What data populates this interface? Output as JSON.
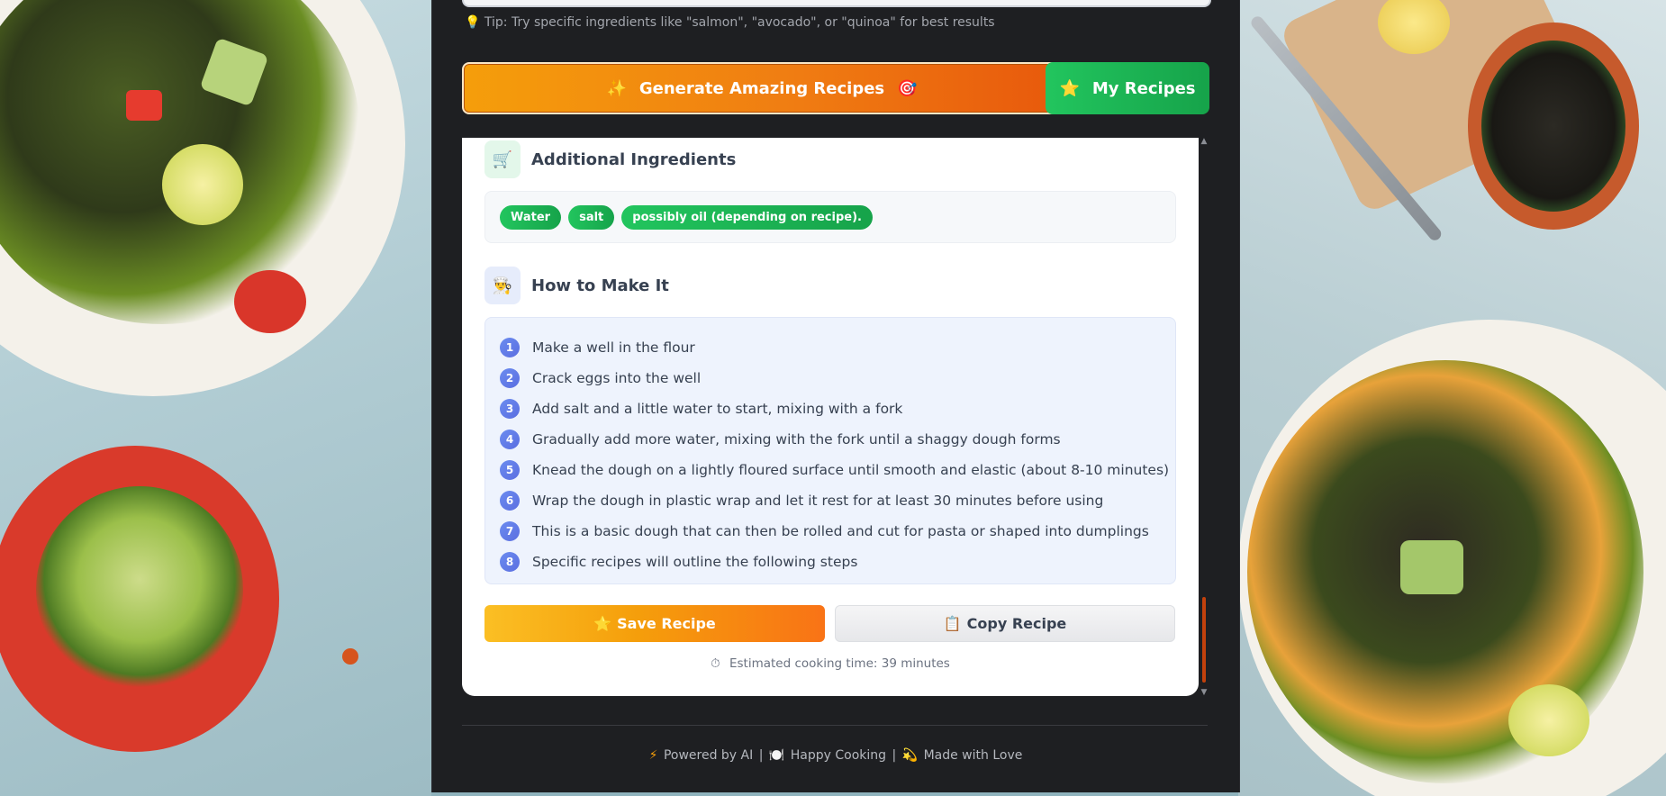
{
  "search": {
    "tip_icon": "lightbulb-icon",
    "tip": "Tip: Try specific ingredients like \"salmon\", \"avocado\", or \"quinoa\" for best results"
  },
  "actions": {
    "generate_label": "Generate Amazing Recipes",
    "generate_icon_left": "sparkles-icon",
    "generate_icon_right": "target-icon",
    "my_recipes_label": "My Recipes",
    "my_recipes_icon": "star-icon"
  },
  "recipe": {
    "additional_ingredients": {
      "title": "Additional Ingredients",
      "icon": "cart-icon",
      "items": [
        "Water",
        "salt",
        "possibly oil (depending on recipe)."
      ]
    },
    "how_to": {
      "title": "How to Make It",
      "icon": "chef-icon",
      "steps": [
        {
          "num": "1",
          "text": "Make a well in the flour"
        },
        {
          "num": "2",
          "text": "Crack eggs into the well"
        },
        {
          "num": "3",
          "text": "Add salt and a little water to start, mixing with a fork"
        },
        {
          "num": "4",
          "text": "Gradually add more water, mixing with the fork until a shaggy dough forms"
        },
        {
          "num": "5",
          "text": "Knead the dough on a lightly floured surface until smooth and elastic (about 8-10 minutes)"
        },
        {
          "num": "6",
          "text": "Wrap the dough in plastic wrap and let it rest for at least 30 minutes before using"
        },
        {
          "num": "7",
          "text": "This is a basic dough that can then be rolled and cut for pasta or shaped into dumplings"
        },
        {
          "num": "8",
          "text": "Specific recipes will outline the following steps"
        }
      ]
    },
    "save_label": "Save Recipe",
    "save_icon": "star-icon",
    "copy_label": "Copy Recipe",
    "copy_icon": "clipboard-icon",
    "cooking_time": "Estimated cooking time: 39 minutes",
    "cooking_time_icon": "stopwatch-icon"
  },
  "footer": {
    "powered": "Powered by AI",
    "happy": "Happy Cooking",
    "love": "Made with Love",
    "separator": "|"
  },
  "colors": {
    "accent_orange": "#f07d12",
    "accent_green": "#22c55e",
    "step_blue": "#5b6ee0",
    "panel_dark": "#1e1f22"
  }
}
